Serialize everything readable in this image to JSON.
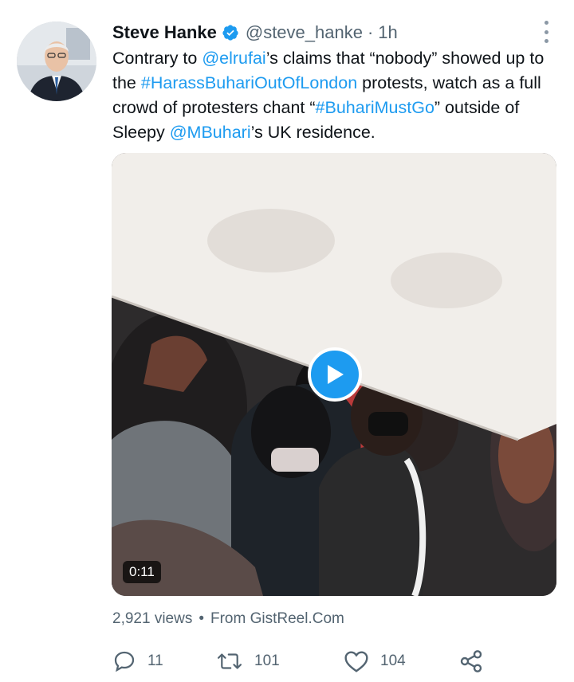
{
  "author": {
    "name": "Steve Hanke",
    "handle": "@steve_hanke",
    "separator": "·",
    "time": "1h"
  },
  "tweet": {
    "segments": [
      {
        "text": "Contrary to ",
        "link": false
      },
      {
        "text": "@elrufai",
        "link": true
      },
      {
        "text": "’s claims that “nobody” showed up to the ",
        "link": false
      },
      {
        "text": "#HarassBuhariOutOfLondon",
        "link": true
      },
      {
        "text": " protests, watch as a full crowd of protesters chant “",
        "link": false
      },
      {
        "text": "#BuhariMustGo",
        "link": true
      },
      {
        "text": "” outside of Sleepy ",
        "link": false
      },
      {
        "text": "@MBuhari",
        "link": true
      },
      {
        "text": "’s UK residence.",
        "link": false
      }
    ]
  },
  "media": {
    "duration": "0:11"
  },
  "meta": {
    "views": "2,921 views",
    "separator": "•",
    "source": "From GistReel.Com"
  },
  "actions": {
    "replies": "11",
    "retweets": "101",
    "likes": "104"
  },
  "colors": {
    "accent": "#1d9bf0",
    "secondary_text": "#536471",
    "primary_text": "#0f1419"
  },
  "icons": [
    "verified-badge-icon",
    "more-options-icon",
    "play-icon",
    "reply-icon",
    "retweet-icon",
    "like-icon",
    "share-icon"
  ]
}
